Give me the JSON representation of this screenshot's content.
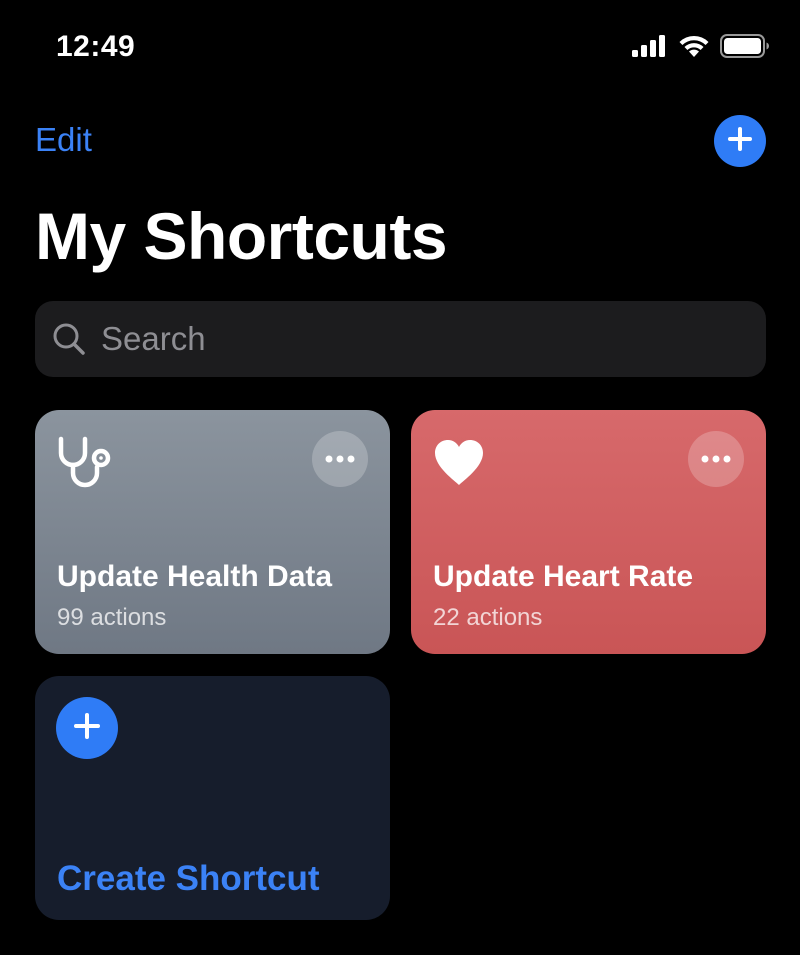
{
  "status_bar": {
    "time": "12:49"
  },
  "nav": {
    "edit_label": "Edit",
    "add_icon": "plus-icon"
  },
  "page": {
    "title": "My Shortcuts"
  },
  "search": {
    "placeholder": "Search",
    "value": ""
  },
  "shortcuts": [
    {
      "title": "Update Health Data",
      "subtitle": "99 actions",
      "icon": "stethoscope-icon",
      "color": "#7d8691"
    },
    {
      "title": "Update Heart Rate",
      "subtitle": "22 actions",
      "icon": "heart-icon",
      "color": "#cf5f60"
    }
  ],
  "create": {
    "label": "Create Shortcut",
    "icon": "plus-icon"
  },
  "colors": {
    "accent": "#2f7cf6",
    "background": "#000000",
    "search_bg": "#1c1c1e",
    "create_card_bg": "#161d2c"
  }
}
